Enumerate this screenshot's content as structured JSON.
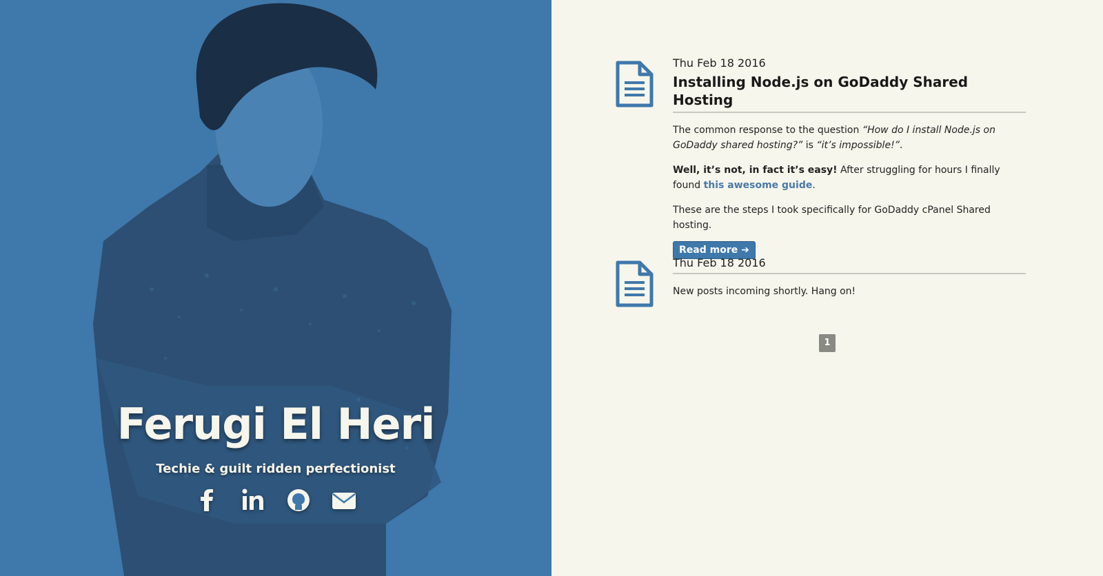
{
  "hero": {
    "name": "Ferugi El Heri",
    "tagline": "Techie & guilt ridden perfectionist",
    "social": [
      {
        "icon": "facebook-icon"
      },
      {
        "icon": "linkedin-icon"
      },
      {
        "icon": "github-icon"
      },
      {
        "icon": "envelope-icon"
      }
    ],
    "colors": {
      "panel": "#3f78ab",
      "text": "#f7f6ec"
    }
  },
  "posts": [
    {
      "date": "Thu Feb 18 2016",
      "title": "Installing Node.js on GoDaddy Shared Hosting",
      "p1_a": "The common response to the question ",
      "p1_q": "“How do I install Node.js on GoDaddy shared hosting?”",
      "p1_b": " is ",
      "p1_c": "“it’s impossible!”",
      "p1_d": ".",
      "p2_bold": "Well, it’s not, in fact it’s easy!",
      "p2_a": " After struggling for hours I finally found ",
      "p2_link": "this awesome guide",
      "p2_b": ".",
      "p3": "These are the steps I took specifically for GoDaddy cPanel Shared hosting.",
      "read_more": "Read more ➔",
      "icon": "document-icon"
    },
    {
      "date": "Thu Feb 18 2016",
      "text": "New posts incoming shortly. Hang on!",
      "icon": "document-icon"
    }
  ],
  "pagination": {
    "current": "1"
  },
  "colors": {
    "background": "#f7f6ec",
    "accent": "#3f78ab",
    "link": "#4a79a8"
  }
}
